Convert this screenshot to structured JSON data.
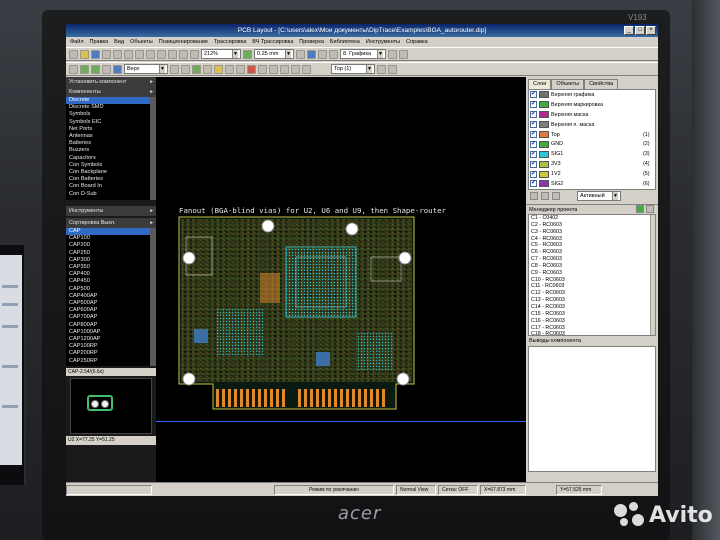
{
  "monitor": {
    "brand": "acer",
    "model_label": "V193"
  },
  "watermark": {
    "text": "Avito"
  },
  "window": {
    "title": "PCB Layout - [C:\\users\\alex\\Мои документы\\DipTrace\\Examples\\BGA_autorouter.dip]"
  },
  "menu": [
    "Файл",
    "Правка",
    "Вид",
    "Объекты",
    "Позиционирование",
    "Трассировка",
    "ВЧ Трассировка",
    "Проверка",
    "Библиотека",
    "Инструменты",
    "Справка"
  ],
  "toolbar": {
    "zoom_value": "212%",
    "width_value": "0.25 mm",
    "layer_mode": "Верх",
    "graphics_layer": "8. Графика",
    "top_layer": "Top (1)"
  },
  "left_panel": {
    "install_component": "Установить компонент",
    "components_header": "Компоненты",
    "libraries": [
      "Discrete",
      "Discrete SMD",
      "Symbols",
      "Symbols EIC",
      "Net Ports",
      "Antennas",
      "Batteries",
      "Buzzers",
      "Capacitors",
      "Con Symbols",
      "Con Backplane",
      "Con Batteries",
      "Con Board In",
      "Con D-Sub"
    ],
    "selected_library": "Discrete",
    "tools_header": "Инструменты",
    "sort_header": "Сортировка Выкл.",
    "components": [
      "CAP",
      "CAP100",
      "CAP200",
      "CAP250",
      "CAP300",
      "CAP350",
      "CAP400",
      "CAP450",
      "CAP500",
      "CAP400AP",
      "CAP500AP",
      "CAP600AP",
      "CAP700AP",
      "CAP800AP",
      "CAP1000AP",
      "CAP1200AP",
      "CAP100RP",
      "CAP200RP",
      "CAP250RP"
    ],
    "selected_component": "CAP",
    "preview_caption": "CAP-2.54/(6.6x)",
    "coords": "U2 X=77.25 Y=51.25"
  },
  "canvas": {
    "board_title": "Fanout (BGA-blind vias) for U2, U6 and U9, then Shape-router"
  },
  "right_panel": {
    "tabs": [
      "Слои",
      "Объекты",
      "Свойства"
    ],
    "layers": [
      {
        "name": "Верхняя графика",
        "num": "",
        "color": "#707070"
      },
      {
        "name": "Верхняя маркировка",
        "num": "",
        "color": "#3fae3f"
      },
      {
        "name": "Верхняя маска",
        "num": "",
        "color": "#b02a8f"
      },
      {
        "name": "Верхняя п. маска",
        "num": "",
        "color": "#7f7f7f"
      },
      {
        "name": "Top",
        "num": "(1)",
        "color": "#e07a3a"
      },
      {
        "name": "GND",
        "num": "(2)",
        "color": "#3fae3f"
      },
      {
        "name": "SIG1",
        "num": "(3)",
        "color": "#2ac5d6"
      },
      {
        "name": "3V3",
        "num": "(4)",
        "color": "#a4c23f"
      },
      {
        "name": "1V2",
        "num": "(5)",
        "color": "#c7c93a"
      },
      {
        "name": "SIG2",
        "num": "(6)",
        "color": "#8a3aa8"
      },
      {
        "name": "GND2",
        "num": "(7)",
        "color": "#3a8a3a"
      }
    ],
    "active_mode": "Активный",
    "project_manager": "Менеджер проекта",
    "components": [
      "C1 - C0402",
      "C2 - RC0603",
      "C3 - RC0603",
      "C4 - RC0603",
      "C5 - RC0603",
      "C6 - RC0603",
      "C7 - RC0603",
      "C8 - RC0603",
      "C9 - RC0603",
      "C10 - RC0603",
      "C11 - RC0603",
      "C12 - RC0603",
      "C13 - RC0603",
      "C14 - RC0603",
      "C15 - RC0603",
      "C16 - RC0603",
      "C17 - RC0603",
      "C18 - RC0603"
    ],
    "component_pins": "Выводы компонента"
  },
  "statusbar": {
    "mode": "Режим по умолчанию",
    "view": "Normal View",
    "snap": "Сетка: OFF",
    "x": "X=67.873 mm",
    "y": "Y=57.525 mm"
  }
}
